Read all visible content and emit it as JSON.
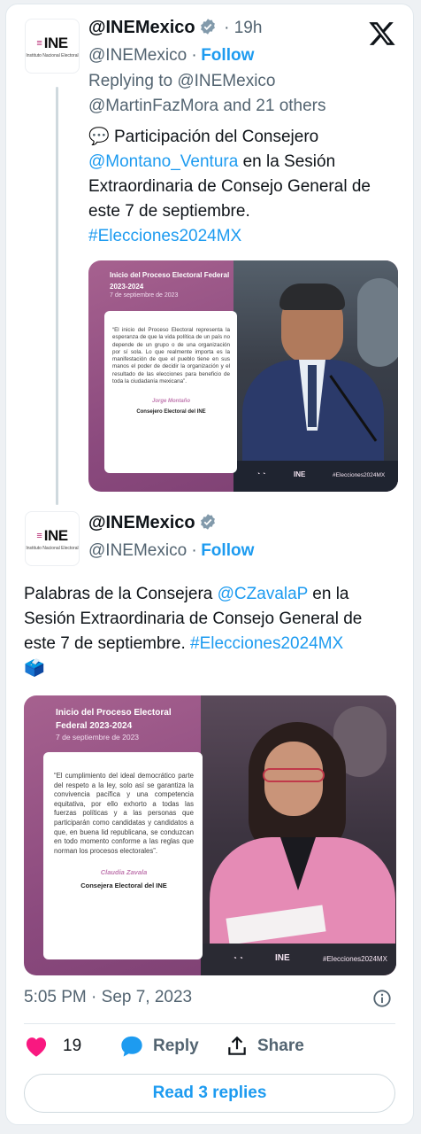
{
  "tweet1": {
    "author_name": "@INEMexico",
    "time": "· 19h",
    "handle": "@INEMexico ·",
    "follow_label": "Follow",
    "replying_prefix": "Replying to ",
    "replying_to": "@INEMexico",
    "replying_others": "@MartinFazMora and 21 others",
    "emoji": "💬",
    "text_1": " Participación del Consejero",
    "mention": "@Montano_Ventura",
    "text_2": " en la Sesión Extraordinaria de Consejo General de este 7 de septiembre.",
    "hashtag": "#Elecciones2024MX",
    "media": {
      "title": "Inicio del Proceso Electoral Federal 2023-2024",
      "date": "7 de septiembre de 2023",
      "quote": "“El inicio del Proceso Electoral representa la esperanza de que la vida política de un país no depende de un grupo o de una organización por sí sola. Lo que realmente importa es la manifestación de que el pueblo tiene en sus manos el poder de decidir la organización y el resultado de las elecciones para beneficio de toda la ciudadanía mexicana”.",
      "author": "Jorge Montaño",
      "role": "Consejero Electoral del INE",
      "footer_logo": "INE",
      "footer_tag": "#Elecciones2024MX"
    }
  },
  "tweet2": {
    "author_name": "@INEMexico",
    "handle": "@INEMexico ·",
    "follow_label": "Follow",
    "text_1": "Palabras de la Consejera ",
    "mention": "@CZavalaP",
    "text_2": " en la Sesión Extraordinaria de Consejo General de este 7 de septiembre. ",
    "hashtag": "#Elecciones2024MX",
    "emoji": "🗳️",
    "media": {
      "title": "Inicio del Proceso Electoral Federal 2023-2024",
      "date": "7 de septiembre de 2023",
      "quote": "“El cumplimiento del ideal democrático parte del respeto a la ley, solo así se garantiza la convivencia pacífica y una competencia equitativa, por ello exhorto a todas las fuerzas políticas y a las personas que participarán como candidatas y candidatos a que, en buena lid republicana, se conduzcan en todo momento conforme a las reglas que norman los procesos electorales”.",
      "author": "Claudia Zavala",
      "role": "Consejera Electoral del INE",
      "footer_logo": "INE",
      "footer_tag": "#Elecciones2024MX"
    },
    "timestamp": "5:05 PM · Sep 7, 2023",
    "likes": "19",
    "reply_label": "Reply",
    "share_label": "Share",
    "read_replies_label": "Read 3 replies"
  },
  "logo": {
    "text": "INE",
    "subtitle": "Instituto Nacional Electoral"
  },
  "colors": {
    "brand_blue": "#1d9bf0",
    "like_red": "#f91880",
    "ine_magenta": "#b5216e"
  }
}
